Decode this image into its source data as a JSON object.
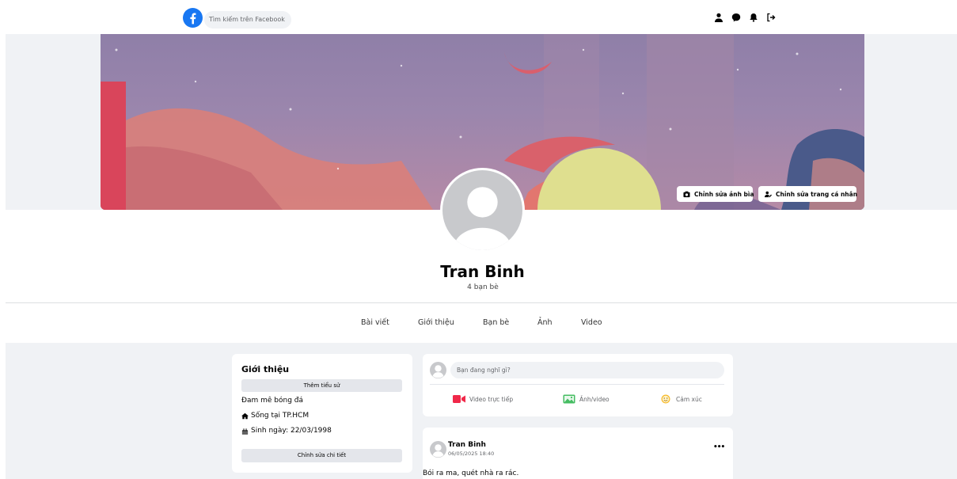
{
  "header": {
    "search_placeholder": "Tìm kiếm trên Facebook",
    "icons": [
      "person-icon",
      "messenger-icon",
      "bell-icon",
      "logout-icon"
    ]
  },
  "cover": {
    "edit_cover_label": "Chỉnh sửa ảnh bìa",
    "edit_profile_label": "Chỉnh sửa trang cá nhân"
  },
  "profile": {
    "name": "Tran Binh",
    "friends_count": "4 bạn bè"
  },
  "tabs": [
    {
      "label": "Bài viết"
    },
    {
      "label": "Giới thiệu"
    },
    {
      "label": "Bạn bè"
    },
    {
      "label": "Ảnh"
    },
    {
      "label": "Video"
    }
  ],
  "intro": {
    "title": "Giới thiệu",
    "add_bio_label": "Thêm tiểu sử",
    "bio": "Đam mê bóng đá",
    "lives_in": "Sống tại TP.HCM",
    "birthday": "Sinh ngày: 22/03/1998",
    "edit_details_label": "Chỉnh sửa chi tiết"
  },
  "composer": {
    "placeholder": "Bạn đang nghĩ gì?",
    "actions": [
      {
        "label": "Video trực tiếp",
        "icon": "live-video-icon",
        "color": "#f02849"
      },
      {
        "label": "Ảnh/video",
        "icon": "photo-icon",
        "color": "#45bd62"
      },
      {
        "label": "Cảm xúc",
        "icon": "feeling-icon",
        "color": "#f7b928"
      }
    ]
  },
  "post": {
    "author": "Tran Binh",
    "timestamp": "06/05/2025 18:40",
    "text": "Bói ra ma, quét nhà ra rác."
  },
  "colors": {
    "brand": "#1877f2",
    "page_bg": "#f0f2f5",
    "card_bg": "#ffffff"
  }
}
